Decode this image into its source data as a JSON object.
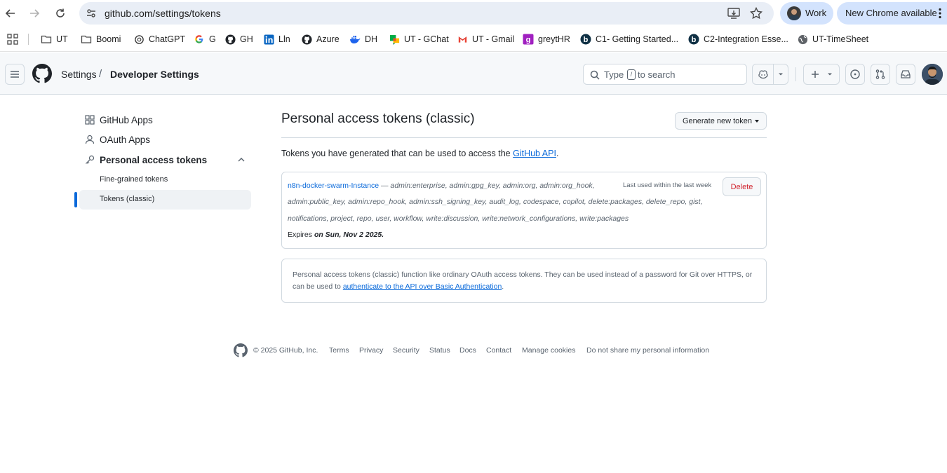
{
  "browser": {
    "url": "github.com/settings/tokens",
    "profile_label": "Work",
    "update_label": "New Chrome available"
  },
  "bookmarks": [
    {
      "label": "UT",
      "icon": "folder-icon"
    },
    {
      "label": "Boomi",
      "icon": "folder-icon"
    },
    {
      "label": "ChatGPT",
      "icon": "chatgpt-icon"
    },
    {
      "label": "G",
      "icon": "google-icon"
    },
    {
      "label": "GH",
      "icon": "github-icon"
    },
    {
      "label": "Lln",
      "icon": "linkedin-icon"
    },
    {
      "label": "Azure",
      "icon": "github-icon"
    },
    {
      "label": "DH",
      "icon": "docker-icon"
    },
    {
      "label": "UT - GChat",
      "icon": "gchat-icon"
    },
    {
      "label": "UT - Gmail",
      "icon": "gmail-icon"
    },
    {
      "label": "greytHR",
      "icon": "greythr-icon"
    },
    {
      "label": "C1- Getting Started...",
      "icon": "b-icon"
    },
    {
      "label": "C2-Integration Esse...",
      "icon": "b-icon"
    },
    {
      "label": "UT-TimeSheet",
      "icon": "globe-icon"
    }
  ],
  "header": {
    "breadcrumb_settings": "Settings",
    "breadcrumb_sep": "/",
    "breadcrumb_dev": "Developer Settings",
    "search_type": "Type",
    "search_key": "/",
    "search_rest": "to search"
  },
  "sidebar": {
    "github_apps": "GitHub Apps",
    "oauth_apps": "OAuth Apps",
    "pat": "Personal access tokens",
    "fine_grained": "Fine-grained tokens",
    "classic": "Tokens (classic)"
  },
  "main": {
    "title": "Personal access tokens (classic)",
    "generate_button": "Generate new token",
    "intro_prefix": "Tokens you have generated that can be used to access the ",
    "intro_link": "GitHub API",
    "intro_suffix": ".",
    "token": {
      "name": "n8n-docker-swarm-Instance",
      "dash": " — ",
      "scopes_line1": "admin:enterprise, admin:gpg_key, admin:org, admin:org_hook,",
      "scopes_line2": "admin:public_key, admin:repo_hook, admin:ssh_signing_key, audit_log, codespace, copilot, delete:packages, delete_repo, gist,",
      "scopes_line3": "notifications, project, repo, user, workflow, write:discussion, write:network_configurations, write:packages",
      "last_used": "Last used within the last week",
      "delete_label": "Delete",
      "expires_prefix": "Expires ",
      "expires_date": "on Sun, Nov 2 2025."
    },
    "info": {
      "line1": "Personal access tokens (classic) function like ordinary OAuth access tokens. They can be used instead of a password for Git over HTTPS, or",
      "line2_prefix": "can be used to ",
      "line2_link": "authenticate to the API over Basic Authentication",
      "line2_suffix": "."
    }
  },
  "footer": {
    "copyright": "© 2025 GitHub, Inc.",
    "terms": "Terms",
    "privacy": "Privacy",
    "security": "Security",
    "status": "Status",
    "docs": "Docs",
    "contact": "Contact",
    "cookies": "Manage cookies",
    "do_not_share": "Do not share my personal information"
  }
}
